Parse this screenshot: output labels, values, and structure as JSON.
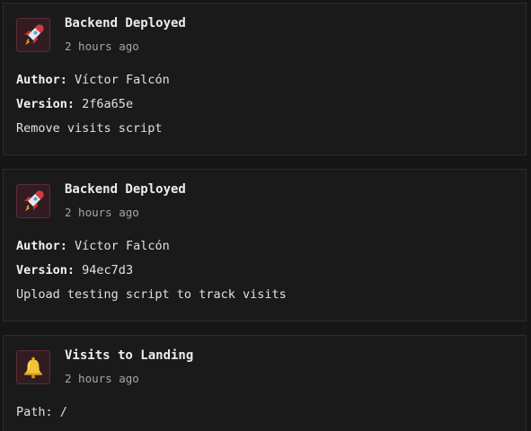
{
  "feed": {
    "events": [
      {
        "icon": "rocket-icon",
        "title": "Backend Deployed",
        "time": "2 hours ago",
        "author_label": "Author:",
        "author": "Víctor Falcón",
        "version_label": "Version:",
        "version": "2f6a65e",
        "message": "Remove visits script"
      },
      {
        "icon": "rocket-icon",
        "title": "Backend Deployed",
        "time": "2 hours ago",
        "author_label": "Author:",
        "author": "Víctor Falcón",
        "version_label": "Version:",
        "version": "94ec7d3",
        "message": "Upload testing script to track visits"
      },
      {
        "icon": "bell-icon",
        "title": "Visits to Landing",
        "time": "2 hours ago",
        "path_label": "Path:",
        "path": "/"
      }
    ]
  },
  "colors": {
    "background": "#161616",
    "card_background": "#1a1a1a",
    "card_border": "#2c2c2c",
    "icon_box_background": "#321c22",
    "icon_box_border": "#5a2d36",
    "title_text": "#ececec",
    "muted_text": "#a6a6a6"
  }
}
